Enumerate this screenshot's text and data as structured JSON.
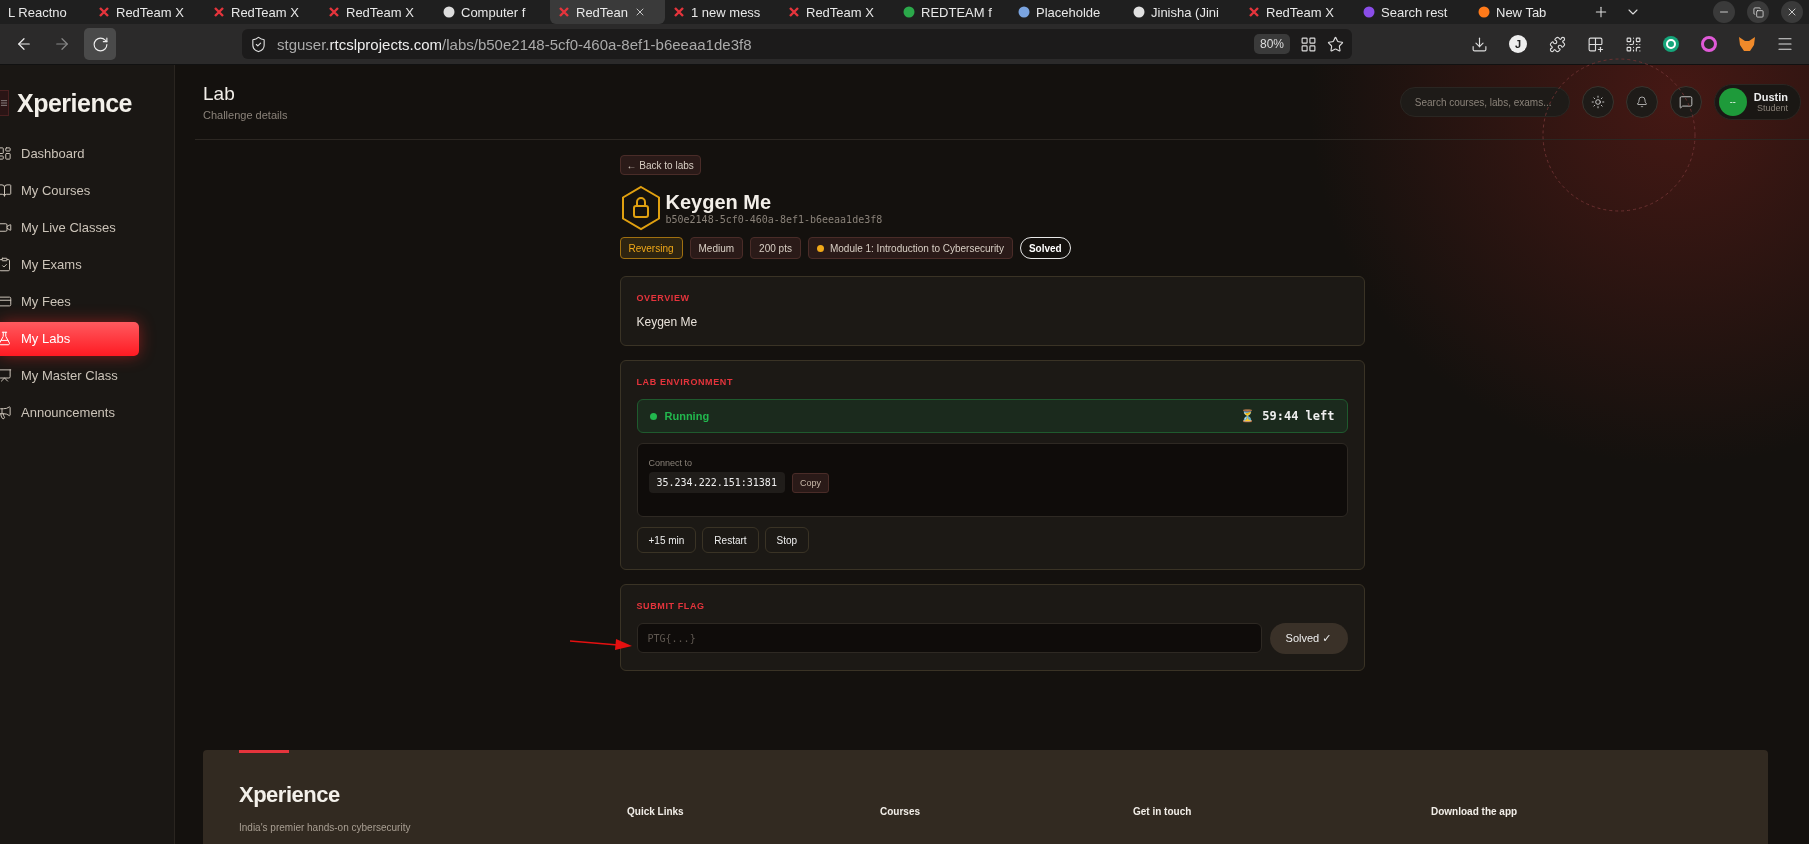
{
  "browser": {
    "tabs": [
      {
        "label": "L Reactno",
        "selected": false
      },
      {
        "label": "RedTeam X",
        "selected": false
      },
      {
        "label": "RedTeam X",
        "selected": false
      },
      {
        "label": "RedTeam X",
        "selected": false
      },
      {
        "label": "Computer f",
        "selected": false
      },
      {
        "label": "RedTean",
        "selected": true
      },
      {
        "label": "1 new mess",
        "selected": false
      },
      {
        "label": "RedTeam X",
        "selected": false
      },
      {
        "label": "REDTEAM f",
        "selected": false
      },
      {
        "label": "Placeholde",
        "selected": false
      },
      {
        "label": "Jinisha (Jini",
        "selected": false
      },
      {
        "label": "RedTeam X",
        "selected": false
      },
      {
        "label": "Search rest",
        "selected": false
      },
      {
        "label": "New Tab",
        "selected": false
      }
    ],
    "url": {
      "subdomain": "stguser.",
      "domain": "rtcslprojects.com",
      "path": "/labs/b50e2148-5cf0-460a-8ef1-b6eeaa1de3f8"
    },
    "zoom": "80%",
    "profile_letter": "J"
  },
  "sidebar": {
    "logo": "Xperience",
    "items": [
      {
        "label": "Dashboard",
        "selected": false
      },
      {
        "label": "My Courses",
        "selected": false
      },
      {
        "label": "My Live Classes",
        "selected": false
      },
      {
        "label": "My Exams",
        "selected": false
      },
      {
        "label": "My Fees",
        "selected": false
      },
      {
        "label": "My Labs",
        "selected": true
      },
      {
        "label": "My Master Class",
        "selected": false
      },
      {
        "label": "Announcements",
        "selected": false
      }
    ]
  },
  "header": {
    "title": "Lab",
    "subtitle": "Challenge details",
    "search_placeholder": "Search courses, labs, exams...",
    "user": {
      "initials": "--",
      "name": "Dustin",
      "role": "Student"
    }
  },
  "lab": {
    "back": "← Back to labs",
    "title": "Keygen Me",
    "id": "b50e2148-5cf0-460a-8ef1-b6eeaa1de3f8",
    "tags": [
      {
        "label": "Reversing",
        "kind": "category"
      },
      {
        "label": "Medium",
        "kind": "plain"
      },
      {
        "label": "200 pts",
        "kind": "plain"
      },
      {
        "label": "Module 1: Introduction to Cybersecurity",
        "kind": "module"
      },
      {
        "label": "Solved",
        "kind": "status"
      }
    ],
    "overview": {
      "heading": "OVERVIEW",
      "text": "Keygen Me"
    },
    "environment": {
      "heading": "LAB ENVIRONMENT",
      "status": "Running",
      "timer": "⏳ 59:44 left",
      "connect_label": "Connect to",
      "address": "35.234.222.151:31381",
      "copy": "Copy",
      "actions": [
        "+15 min",
        "Restart",
        "Stop"
      ]
    },
    "submit": {
      "heading": "SUBMIT FLAG",
      "placeholder": "PTG{...}",
      "button": "Solved ✓"
    }
  },
  "footer": {
    "logo": "Xperience",
    "tagline": "India's premier hands-on cybersecurity",
    "columns": [
      "Quick Links",
      "Courses",
      "Get in touch",
      "Download the app"
    ]
  }
}
